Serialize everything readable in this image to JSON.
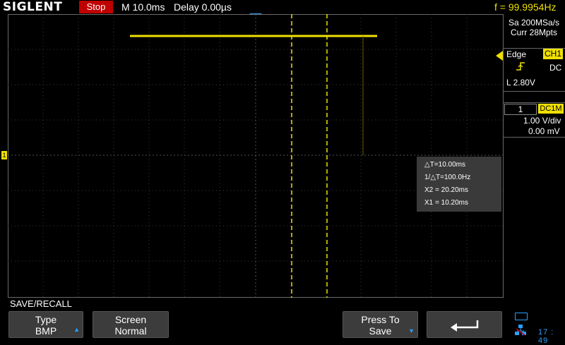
{
  "header": {
    "brand": "SIGLENT",
    "run_state": "Stop",
    "timebase": "M 10.0ms",
    "delay": "Delay 0.00µs",
    "frequency": "f = 99.9954Hz"
  },
  "acquisition": {
    "sample_rate": "Sa 200MSa/s",
    "memory_depth": "Curr 28Mpts"
  },
  "trigger": {
    "type": "Edge",
    "source": "CH1",
    "slope_icon": "rising-edge-icon",
    "coupling": "DC",
    "level": "L  2.80V"
  },
  "channel": {
    "number": "1",
    "coupling": "DC1M",
    "volts_per_div": "1.00 V/div",
    "offset": "0.00 mV",
    "marker_label": "1",
    "color": "#f0e000"
  },
  "cursor_measurements": {
    "delta_t": "△T=10.00ms",
    "inverse_delta_t": "1/△T=100.0Hz",
    "x2": "X2 = 20.20ms",
    "x1": "X1 = 10.20ms"
  },
  "softkeys": {
    "menu_title": "SAVE/RECALL",
    "type_label": "Type",
    "type_value": "BMP",
    "screen_label": "Screen",
    "screen_value": "Normal",
    "press_label": "Press To",
    "press_value": "Save",
    "back_icon": "return-arrow-icon"
  },
  "status": {
    "clock": "17 : 49"
  },
  "colors": {
    "channel1": "#f0e000",
    "stop": "#c00000",
    "accent": "#2aa0ff"
  }
}
